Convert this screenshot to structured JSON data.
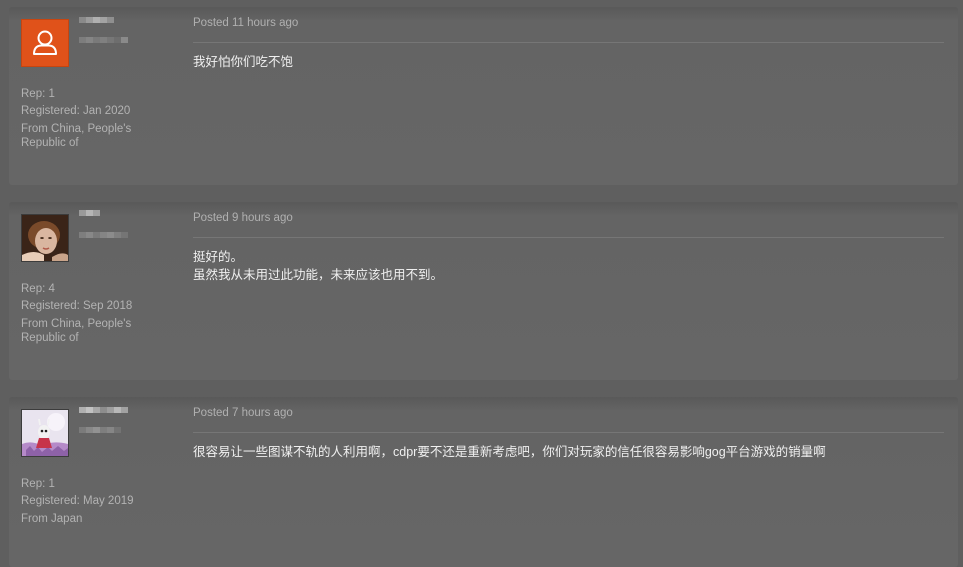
{
  "posts": [
    {
      "avatar": "default-user-icon",
      "rep": "Rep: 1",
      "registered": "Registered: Jan 2020",
      "from": "From China, People's Republic of",
      "posted": "Posted 11 hours ago",
      "body": [
        "我好怕你们吃不饱"
      ]
    },
    {
      "avatar": "portrait-photo",
      "rep": "Rep: 4",
      "registered": "Registered: Sep 2018",
      "from": "From China, People's Republic of",
      "posted": "Posted 9 hours ago",
      "body": [
        "挺好的。",
        "虽然我从未用过此功能，未来应该也用不到。"
      ]
    },
    {
      "avatar": "knight-illustration",
      "rep": "Rep: 1",
      "registered": "Registered: May 2019",
      "from": "From Japan",
      "posted": "Posted 7 hours ago",
      "body": [
        "很容易让一些图谋不轨的人利用啊，cdpr要不还是重新考虑吧，你们对玩家的信任很容易影响gog平台游戏的销量啊"
      ]
    }
  ],
  "colors": {
    "page_bg": "#5f5f5f",
    "post_bg": "#666666",
    "meta_text": "#b3b3b3",
    "body_text": "#f0f0f0",
    "default_avatar": "#e0521a"
  }
}
